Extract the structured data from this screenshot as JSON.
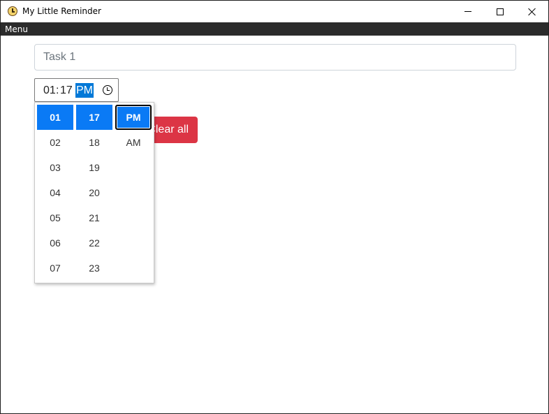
{
  "window": {
    "title": "My Little Reminder",
    "icon": "clock-app-icon"
  },
  "menubar": {
    "items": [
      "Menu"
    ]
  },
  "task": {
    "placeholder": "Task 1"
  },
  "time": {
    "hour": "01",
    "colon": ":",
    "minute": "17",
    "ampm": "PM"
  },
  "picker": {
    "hours": [
      "01",
      "02",
      "03",
      "04",
      "05",
      "06",
      "07"
    ],
    "minutes": [
      "17",
      "18",
      "19",
      "20",
      "21",
      "22",
      "23"
    ],
    "ampm": [
      "PM",
      "AM"
    ],
    "selected_hour": "01",
    "selected_minute": "17",
    "selected_ampm": "PM"
  },
  "actions": {
    "clear_all_label": "Clear all"
  },
  "colors": {
    "accent": "#0a7af5",
    "danger": "#dc3545",
    "menubar": "#2b2b2b"
  }
}
